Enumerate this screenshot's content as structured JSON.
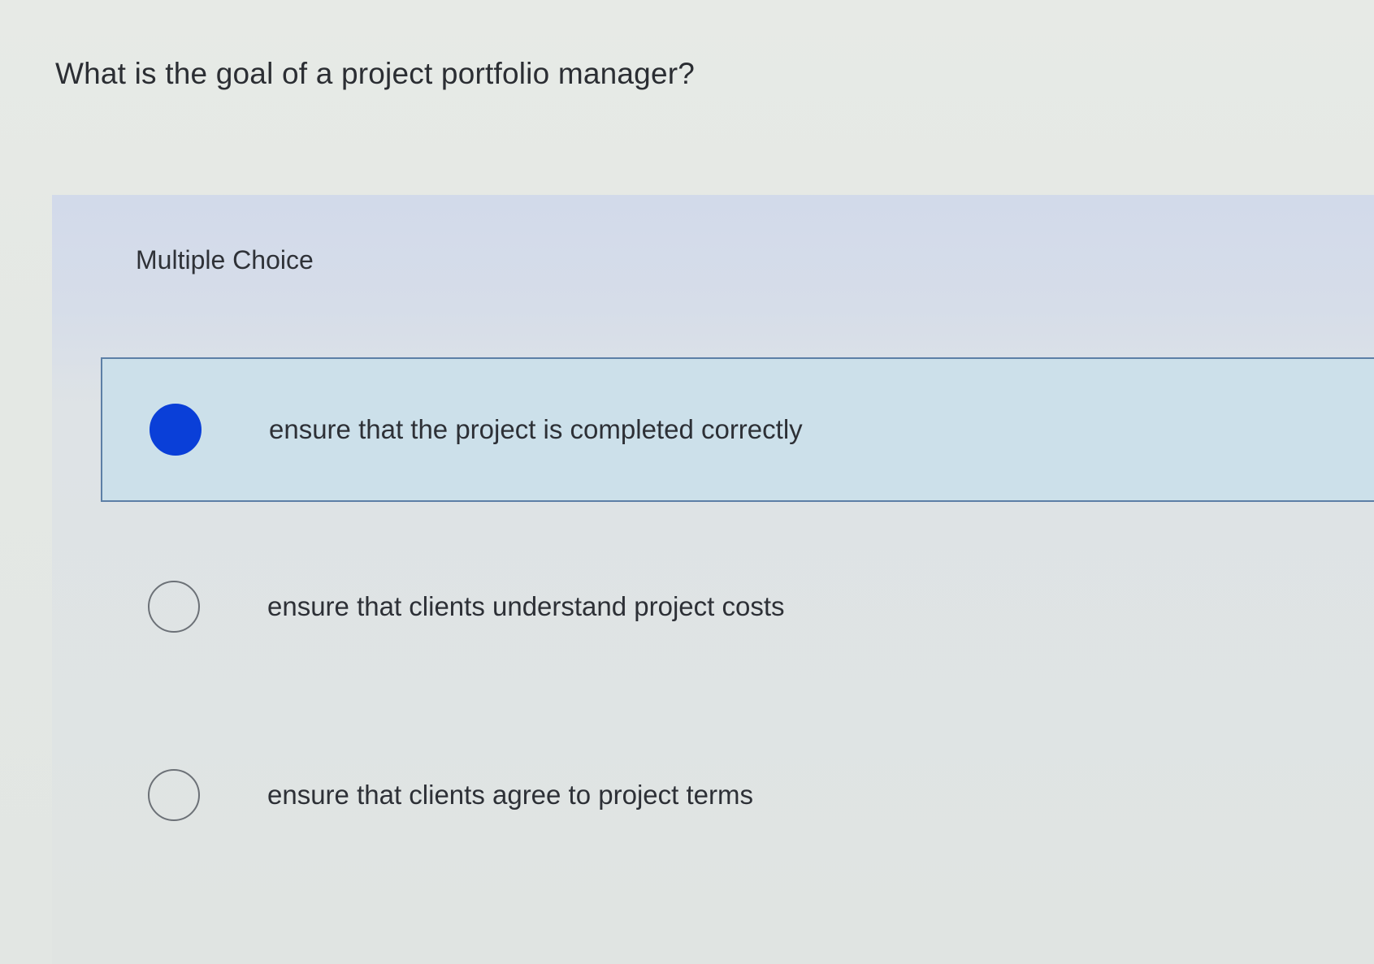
{
  "question": {
    "text": "What is the goal of a project portfolio manager?"
  },
  "multiple_choice": {
    "label": "Multiple Choice",
    "options": [
      {
        "label": "ensure that the project is completed correctly",
        "selected": true
      },
      {
        "label": "ensure that clients understand project costs",
        "selected": false
      },
      {
        "label": "ensure that clients agree to project terms",
        "selected": false
      }
    ]
  },
  "colors": {
    "selected_radio": "#0a3fd8",
    "selected_background": "#cce0ea",
    "selected_border": "#5c7fa6",
    "panel_header": "#d2daea",
    "text": "#2d3036"
  },
  "icons": {
    "selected": "radio-selected-icon",
    "unselected": "radio-unselected-icon"
  }
}
